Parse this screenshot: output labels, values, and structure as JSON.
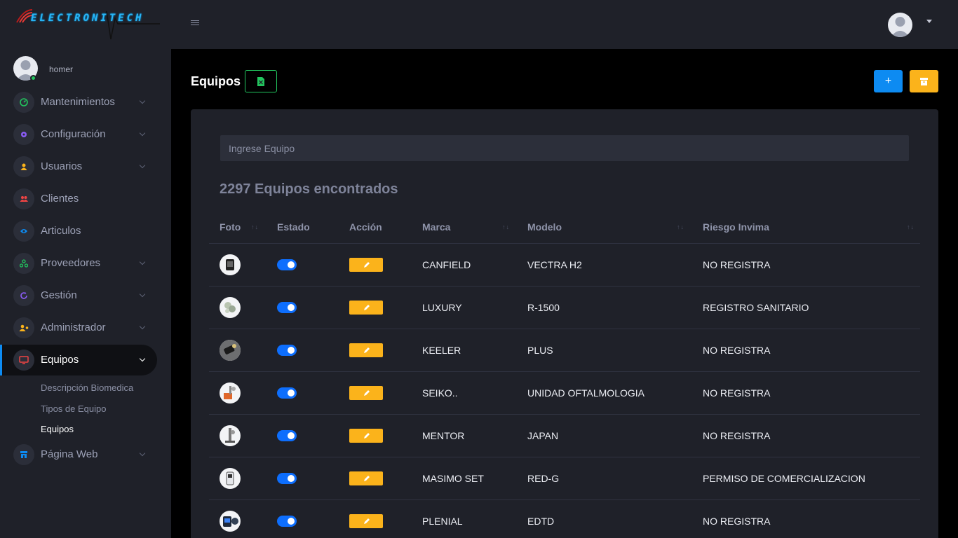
{
  "brand": {
    "logo_text": "ELECTRONITECH"
  },
  "user": {
    "name": "homer"
  },
  "sidebar": {
    "items": [
      {
        "label": "Mantenimientos",
        "icon": "gauge-icon",
        "color": "#22c55e",
        "has_children": true
      },
      {
        "label": "Configuración",
        "icon": "gear-icon",
        "color": "#8b5cf6",
        "has_children": true
      },
      {
        "label": "Usuarios",
        "icon": "user-icon",
        "color": "#fbb31b",
        "has_children": true
      },
      {
        "label": "Clientes",
        "icon": "users-icon",
        "color": "#ef4444",
        "has_children": false
      },
      {
        "label": "Articulos",
        "icon": "eye-icon",
        "color": "#0d8bf2",
        "has_children": false
      },
      {
        "label": "Proveedores",
        "icon": "network-icon",
        "color": "#22c55e",
        "has_children": true
      },
      {
        "label": "Gestión",
        "icon": "refresh-icon",
        "color": "#8b5cf6",
        "has_children": true
      },
      {
        "label": "Administrador",
        "icon": "user-cog-icon",
        "color": "#fbb31b",
        "has_children": true
      },
      {
        "label": "Equipos",
        "icon": "monitor-icon",
        "color": "#ef4444",
        "has_children": true,
        "active": true
      },
      {
        "label": "Página Web",
        "icon": "store-icon",
        "color": "#0d8bf2",
        "has_children": true
      }
    ],
    "equipos_sub": [
      {
        "label": "Descripción Biomedica"
      },
      {
        "label": "Tipos de Equipo"
      },
      {
        "label": "Equipos",
        "current": true
      }
    ]
  },
  "main": {
    "title": "Equipos",
    "add_label": "+",
    "search_placeholder": "Ingrese Equipo",
    "found_text": "2297 Equipos encontrados",
    "columns": {
      "foto": "Foto",
      "estado": "Estado",
      "accion": "Acción",
      "marca": "Marca",
      "modelo": "Modelo",
      "riesgo": "Riesgo Invima"
    },
    "rows": [
      {
        "marca": "CANFIELD",
        "modelo": "VECTRA H2",
        "riesgo": "NO REGISTRA",
        "estado": true
      },
      {
        "marca": "LUXURY",
        "modelo": "R-1500",
        "riesgo": "REGISTRO SANITARIO",
        "estado": true
      },
      {
        "marca": "KEELER",
        "modelo": "PLUS",
        "riesgo": "NO REGISTRA",
        "estado": true
      },
      {
        "marca": "SEIKO..",
        "modelo": "UNIDAD OFTALMOLOGIA",
        "riesgo": "NO REGISTRA",
        "estado": true
      },
      {
        "marca": "MENTOR",
        "modelo": "JAPAN",
        "riesgo": "NO REGISTRA",
        "estado": true
      },
      {
        "marca": "MASIMO SET",
        "modelo": "RED-G",
        "riesgo": "PERMISO DE COMERCIALIZACION",
        "estado": true
      },
      {
        "marca": "PLENIAL",
        "modelo": "EDTD",
        "riesgo": "NO REGISTRA",
        "estado": true
      }
    ]
  }
}
